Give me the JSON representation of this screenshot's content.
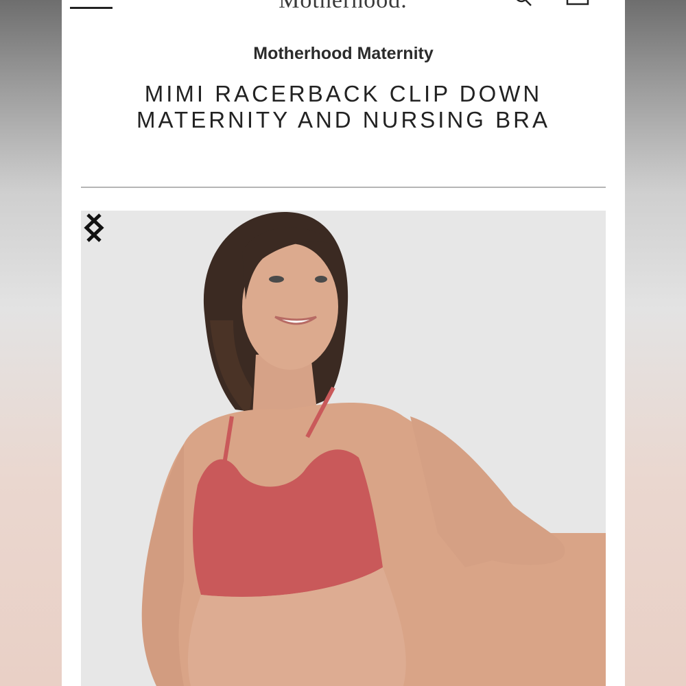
{
  "header": {
    "logo_text": "Motherhood.",
    "menu_icon": "hamburger-menu-icon",
    "search_icon": "search-icon",
    "bag_icon": "shopping-bag-icon"
  },
  "product": {
    "brand": "Motherhood Maternity",
    "title": "MIMI RACERBACK CLIP DOWN MATERNITY AND NURSING BRA"
  },
  "gallery": {
    "prev_icon": "chevron-left-icon",
    "next_icon": "chevron-right-icon"
  },
  "colors": {
    "bra": "#c9595a",
    "background": "#e7e7e7",
    "text": "#222222"
  }
}
